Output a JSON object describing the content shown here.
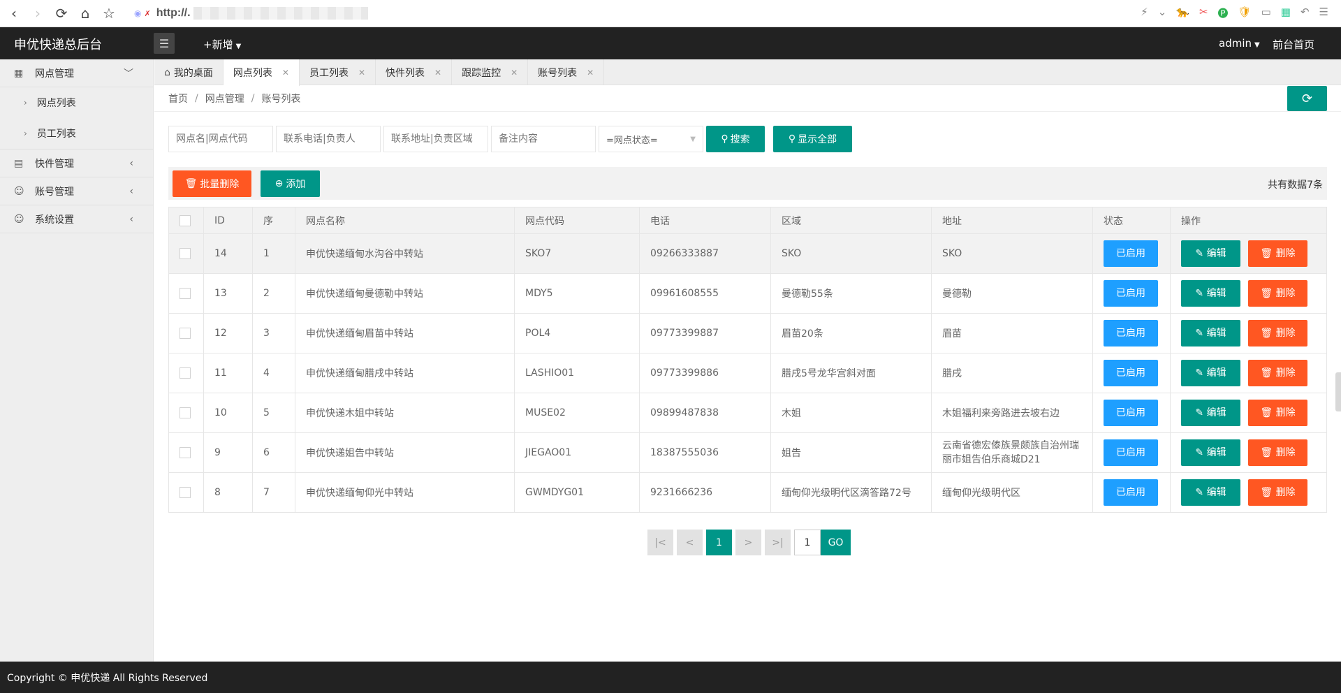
{
  "browser": {
    "url_text": "http://.",
    "right_glyphs": [
      "⚡",
      "⌄",
      "🐆",
      "✂",
      "🅟",
      "🛡",
      "▭",
      "▦",
      "↶",
      "☰"
    ]
  },
  "header": {
    "title": "申优快递总后台",
    "menu_icon": "☰",
    "add_new": "+新增",
    "user": "admin",
    "front_page": "前台首页"
  },
  "sidebar": {
    "groups": [
      {
        "label": "网点管理",
        "icon": "▦",
        "arrow": "﹀",
        "expanded": true,
        "items": [
          "网点列表",
          "员工列表"
        ]
      },
      {
        "label": "快件管理",
        "icon": "▤",
        "arrow": "‹"
      },
      {
        "label": "账号管理",
        "icon": "☺",
        "arrow": "‹"
      },
      {
        "label": "系统设置",
        "icon": "☺",
        "arrow": "‹"
      }
    ]
  },
  "tabs": [
    {
      "label": "我的桌面",
      "home": true,
      "active": false,
      "closable": false
    },
    {
      "label": "网点列表",
      "active": true,
      "closable": true
    },
    {
      "label": "员工列表",
      "active": false,
      "closable": true
    },
    {
      "label": "快件列表",
      "active": false,
      "closable": true
    },
    {
      "label": "跟踪监控",
      "active": false,
      "closable": true
    },
    {
      "label": "账号列表",
      "active": false,
      "closable": true
    }
  ],
  "breadcrumb": [
    "首页",
    "网点管理",
    "账号列表"
  ],
  "refresh_icon": "⟳",
  "search": {
    "name_placeholder": "网点名|网点代码",
    "phone_placeholder": "联系电话|负责人",
    "address_placeholder": "联系地址|负责区域",
    "note_placeholder": "备注内容",
    "status_select": "=网点状态=",
    "search_button": "搜索",
    "show_all_button": "显示全部"
  },
  "toolbar": {
    "batch_delete": "批量删除",
    "add": "添加",
    "total": "共有数据7条"
  },
  "table": {
    "columns": [
      "ID",
      "序",
      "网点名称",
      "网点代码",
      "电话",
      "区域",
      "地址",
      "状态",
      "操作"
    ],
    "rows": [
      {
        "id": "14",
        "seq": "1",
        "name": "申优快递缅甸水沟谷中转站",
        "code": "SKO7",
        "phone": "09266333887",
        "area": "SKO",
        "address": "SKO",
        "status": "已启用"
      },
      {
        "id": "13",
        "seq": "2",
        "name": "申优快递缅甸曼德勒中转站",
        "code": "MDY5",
        "phone": "09961608555",
        "area": "曼德勒55条",
        "address": "曼德勒",
        "status": "已启用"
      },
      {
        "id": "12",
        "seq": "3",
        "name": "申优快递缅甸眉苗中转站",
        "code": "POL4",
        "phone": "09773399887",
        "area": "眉苗20条",
        "address": "眉苗",
        "status": "已启用"
      },
      {
        "id": "11",
        "seq": "4",
        "name": "申优快递缅甸腊戌中转站",
        "code": "LASHIO01",
        "phone": "09773399886",
        "area": "腊戌5号龙华宫斜对面",
        "address": "腊戌",
        "status": "已启用"
      },
      {
        "id": "10",
        "seq": "5",
        "name": "申优快递木姐中转站",
        "code": "MUSE02",
        "phone": "09899487838",
        "area": "木姐",
        "address": "木姐福利来旁路进去坡右边",
        "status": "已启用"
      },
      {
        "id": "9",
        "seq": "6",
        "name": "申优快递姐告中转站",
        "code": "JIEGAO01",
        "phone": "18387555036",
        "area": "姐告",
        "address": "云南省德宏傣族景颇族自治州瑞丽市姐告伯乐商城D21",
        "status": "已启用"
      },
      {
        "id": "8",
        "seq": "7",
        "name": "申优快递缅甸仰光中转站",
        "code": "GWMDYG01",
        "phone": "9231666236",
        "area": "缅甸仰光级明代区滴答路72号",
        "address": "缅甸仰光级明代区",
        "status": "已启用"
      }
    ],
    "edit_label": "编辑",
    "delete_label": "删除"
  },
  "pagination": {
    "first": "|<",
    "prev": "<",
    "current": "1",
    "next": ">",
    "last": ">|",
    "jump_value": "1",
    "go": "GO"
  },
  "footer": {
    "text": "Copyright © 申优快递 All Rights Reserved"
  }
}
